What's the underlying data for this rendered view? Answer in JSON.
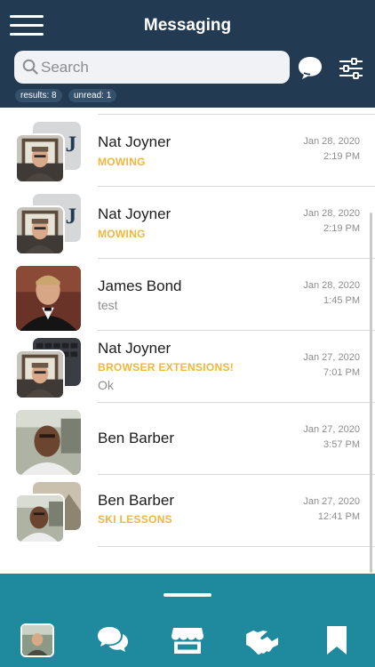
{
  "header": {
    "title": "Messaging",
    "search_placeholder": "Search",
    "badges": {
      "results": "results: 8",
      "unread": "unread: 1"
    }
  },
  "conversations": [
    {
      "name": "Nat Joyner",
      "subject": "MOWING",
      "preview": "",
      "date": "Jan 28, 2020",
      "time": "2:19 PM"
    },
    {
      "name": "Nat Joyner",
      "subject": "MOWING",
      "preview": "",
      "date": "Jan 28, 2020",
      "time": "2:19 PM"
    },
    {
      "name": "James Bond",
      "subject": "",
      "preview": "test",
      "date": "Jan 28, 2020",
      "time": "1:45 PM"
    },
    {
      "name": "Nat Joyner",
      "subject": "BROWSER EXTENSIONS!",
      "preview": "Ok",
      "date": "Jan 27, 2020",
      "time": "7:01 PM"
    },
    {
      "name": "Ben Barber",
      "subject": "",
      "preview": "",
      "date": "Jan 27, 2020",
      "time": "3:57 PM"
    },
    {
      "name": "Ben Barber",
      "subject": "SKI LESSONS",
      "preview": "",
      "date": "Jan 27, 2020",
      "time": "12:41 PM"
    }
  ],
  "icons": {
    "menu": "hamburger-menu-icon",
    "search": "search-icon",
    "new_message": "chat-bubble-icon",
    "filter": "sliders-icon",
    "nav": [
      "profile-avatar",
      "chat-bubbles-icon",
      "storefront-icon",
      "handshake-icon",
      "bookmark-icon"
    ]
  },
  "colors": {
    "header": "#223a52",
    "accent_subject": "#f2b63b",
    "bottom_bar": "#1f8a9e"
  }
}
